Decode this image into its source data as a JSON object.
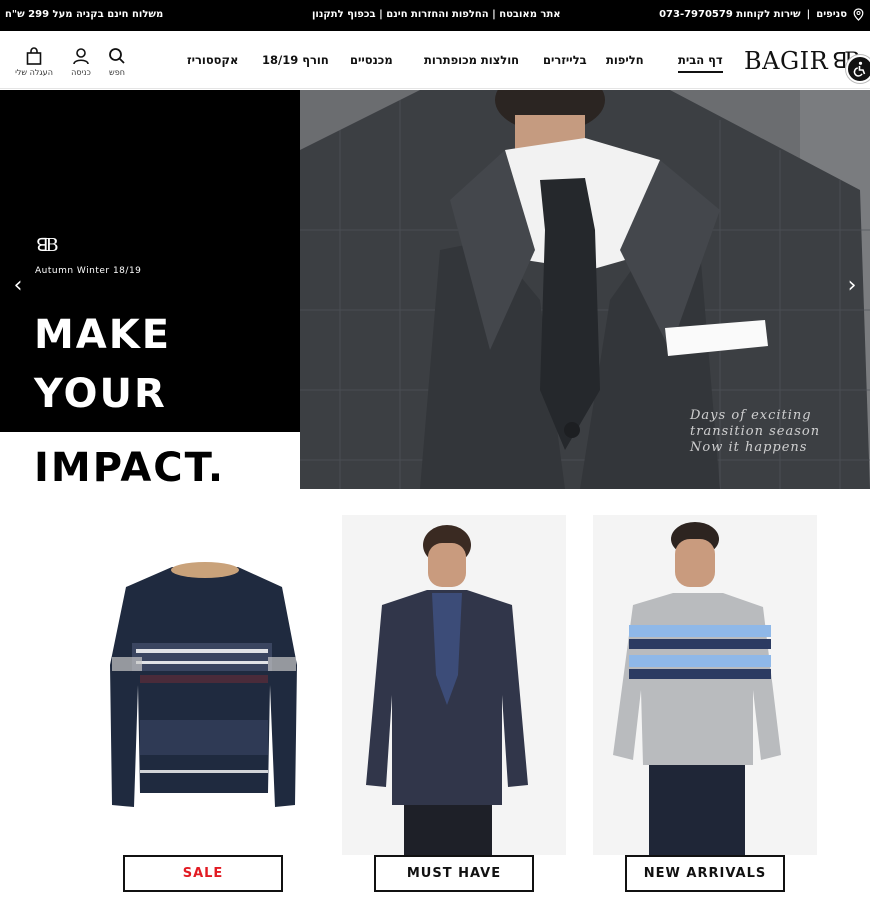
{
  "topbar": {
    "shipping_msg": "משלוח חינם בקניה מעל 299 ש\"ח",
    "middle_msg": "אתר מאובטח | החלפות והחזרות חינם | בכפוף לתקנון",
    "branches_label": "סניפים",
    "service_label": "שירות לקוחות 073-7970579"
  },
  "header": {
    "logo_text": "BAGIR",
    "nav": [
      {
        "label": "דף הבית",
        "active": true
      },
      {
        "label": "חליפות"
      },
      {
        "label": "בלייזרים"
      },
      {
        "label": "חולצות מכופתרות"
      },
      {
        "label": "מכנסיים"
      },
      {
        "label": "חורף 18/19"
      },
      {
        "label": "אקססוריז"
      }
    ],
    "icons": {
      "search_label": "חפש",
      "login_label": "כניסה",
      "cart_label": "העגלה שלי"
    }
  },
  "hero": {
    "season": "Autumn Winter 18/19",
    "headline": [
      "MAKE",
      "YOUR",
      "IMPACT."
    ],
    "tagline": [
      "Days of exciting",
      "transition season",
      "Now it happens"
    ]
  },
  "categories": [
    {
      "label": "SALE",
      "color": "#e21b23"
    },
    {
      "label": "MUST HAVE",
      "color": "#111111"
    },
    {
      "label": "NEW ARRIVALS",
      "color": "#111111"
    }
  ]
}
